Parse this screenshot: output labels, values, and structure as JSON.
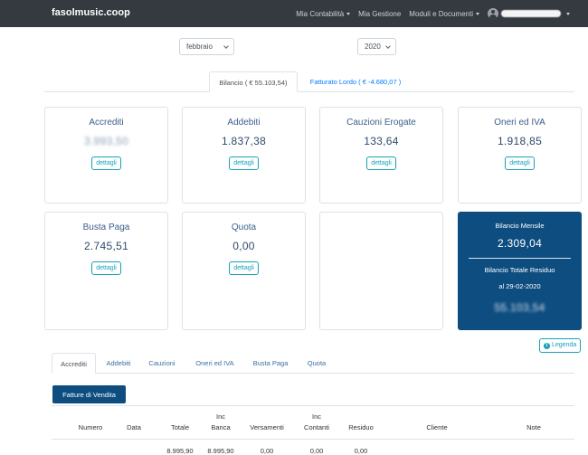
{
  "navbar": {
    "brand": "fasolmusic.coop",
    "menu": [
      "Mia Contabilità",
      "Mia Gestione",
      "Moduli e Documenti"
    ]
  },
  "filters": {
    "month": "febbraio",
    "year": "2020"
  },
  "top_tabs": [
    {
      "label": "Bilancio ( € 55.103,54)",
      "active": true
    },
    {
      "label": "Fatturato Lordo ( € -4.680,07 )",
      "active": false
    }
  ],
  "cards": [
    {
      "title": "Accrediti",
      "value": "3.993,50",
      "button": "dettagli"
    },
    {
      "title": "Addebiti",
      "value": "1.837,38",
      "button": "dettagli"
    },
    {
      "title": "Cauzioni Erogate",
      "value": "133,64",
      "button": "dettagli"
    },
    {
      "title": "Oneri ed IVA",
      "value": "1.918,85",
      "button": "dettagli"
    },
    {
      "title": "Busta Paga",
      "value": "2.745,51",
      "button": "dettagli"
    },
    {
      "title": "Quota",
      "value": "0,00",
      "button": "dettagli"
    }
  ],
  "summary": {
    "monthly_label": "Bilancio Mensile",
    "monthly_value": "2.309,04",
    "total_label": "Bilancio Totale Residuo",
    "total_date": "al 29-02-2020",
    "total_value": "55.103,54"
  },
  "legend_button": "Legenda",
  "bottom_tabs": [
    {
      "label": "Accrediti",
      "active": true
    },
    {
      "label": "Addebiti",
      "active": false
    },
    {
      "label": "Cauzioni",
      "active": false
    },
    {
      "label": "Oneri ed IVA",
      "active": false
    },
    {
      "label": "Busta Paga",
      "active": false
    },
    {
      "label": "Quota",
      "active": false
    }
  ],
  "fatture_button": "Fatture di Vendita",
  "table": {
    "headers": {
      "numero": "Numero",
      "data": "Data",
      "totale": "Totale",
      "inc_banca_1": "Inc",
      "inc_banca_2": "Banca",
      "versamenti": "Versamenti",
      "inc_contanti_1": "Inc",
      "inc_contanti_2": "Contanti",
      "residuo": "Residuo",
      "cliente": "Cliente",
      "note": "Note"
    },
    "row": {
      "totale": "8.995,90",
      "inc_banca": "8.995,90",
      "versamenti": "0,00",
      "inc_contanti": "0,00",
      "residuo": "0,00"
    }
  }
}
